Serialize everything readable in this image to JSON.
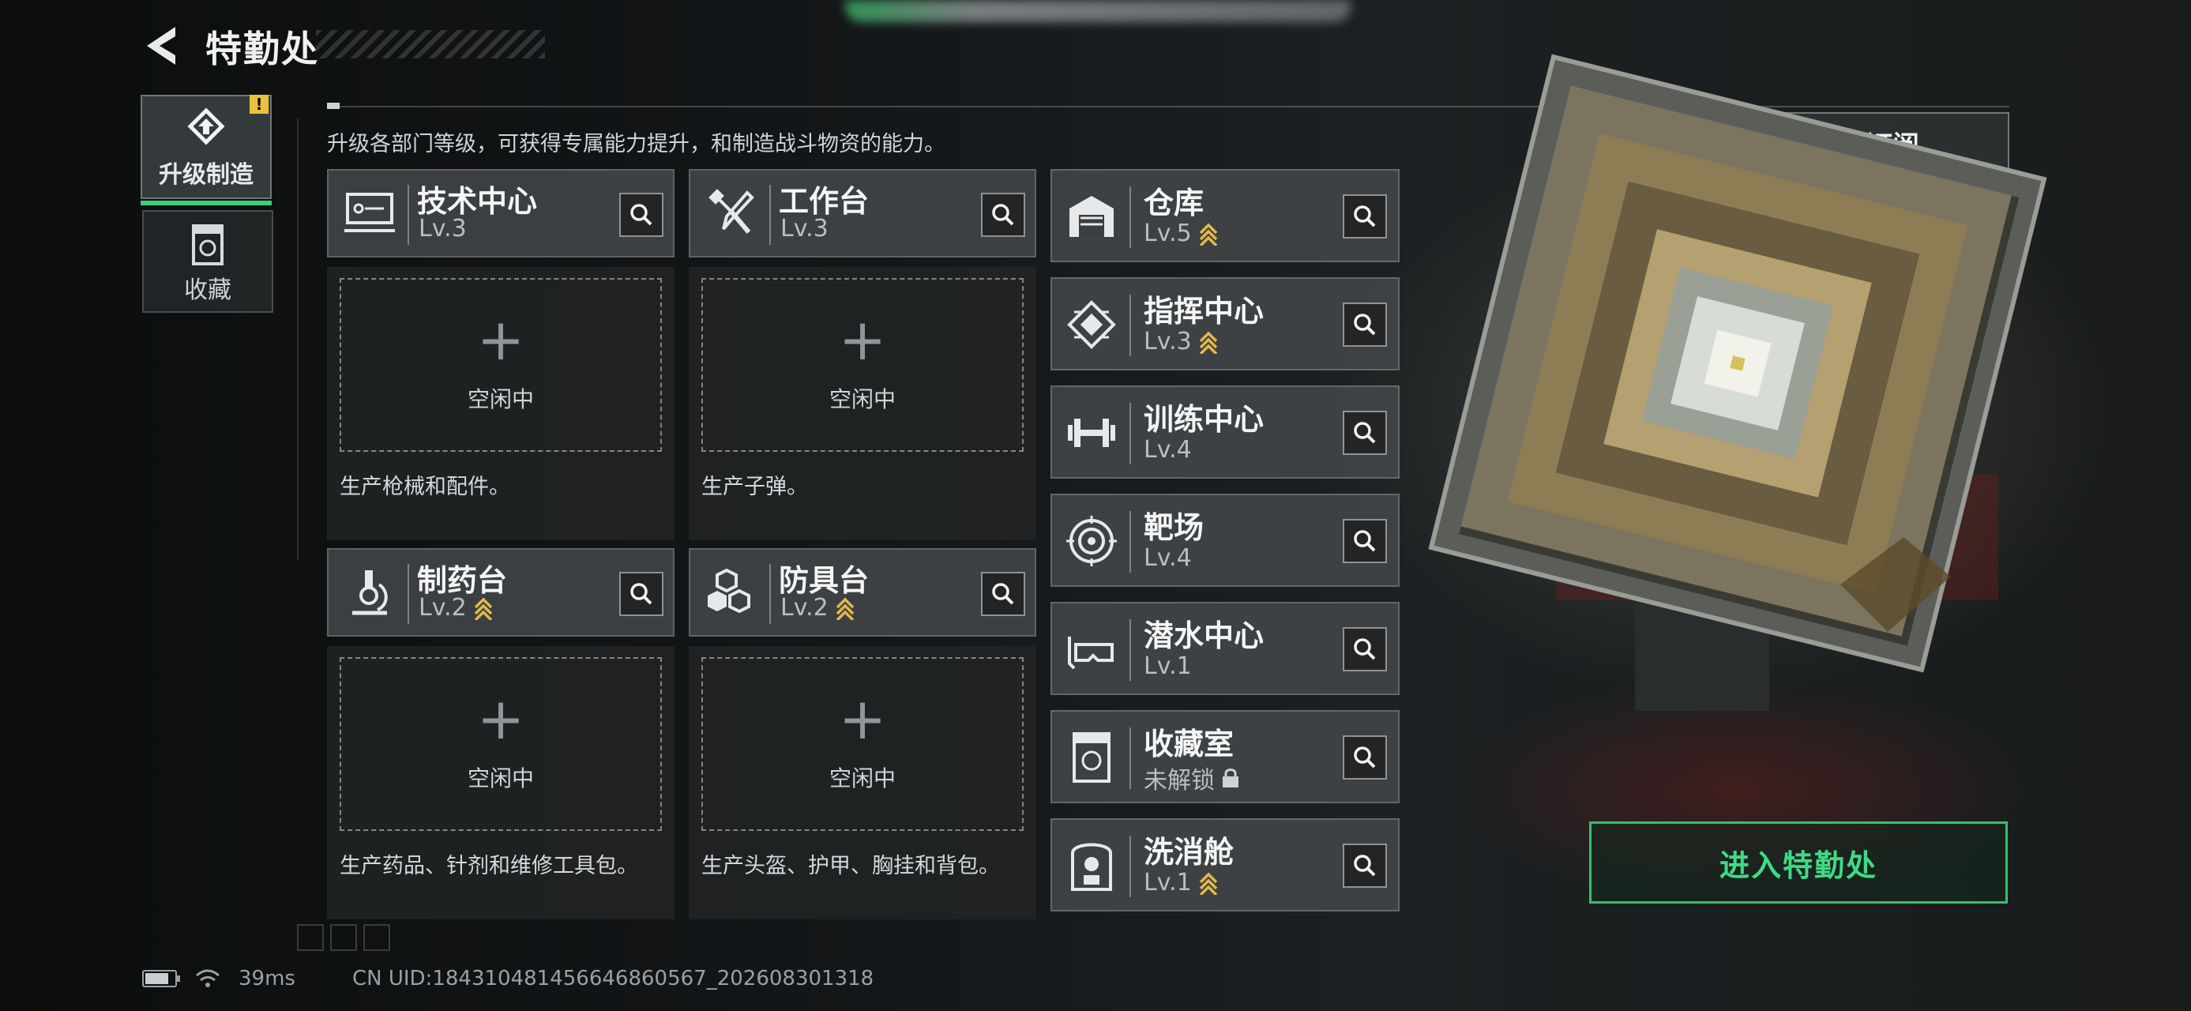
{
  "header": {
    "title": "特勤处",
    "back_icon": "back-arrow-icon"
  },
  "sidebar": {
    "tabs": [
      {
        "label": "升级制造",
        "icon": "upgrade-icon",
        "active": true,
        "alert": "!"
      },
      {
        "label": "收藏",
        "icon": "collection-icon",
        "active": false
      }
    ]
  },
  "description": "升级各部门等级，可获得专属能力提升，和制造战斗物资的能力。",
  "subscribe": {
    "label": "订阅",
    "icon": "bell-plus-icon"
  },
  "production": [
    {
      "name": "技术中心",
      "level": "Lv.3",
      "icon": "computer-icon",
      "upgradable": false,
      "slot_plus": "+",
      "slot_status": "空闲中",
      "desc": "生产枪械和配件。"
    },
    {
      "name": "工作台",
      "level": "Lv.3",
      "icon": "tools-icon",
      "upgradable": false,
      "slot_plus": "+",
      "slot_status": "空闲中",
      "desc": "生产子弹。"
    },
    {
      "name": "制药台",
      "level": "Lv.2",
      "icon": "microscope-icon",
      "upgradable": true,
      "slot_plus": "+",
      "slot_status": "空闲中",
      "desc": "生产药品、针剂和维修工具包。"
    },
    {
      "name": "防具台",
      "level": "Lv.2",
      "icon": "armor-blocks-icon",
      "upgradable": true,
      "slot_plus": "+",
      "slot_status": "空闲中",
      "desc": "生产头盔、护甲、胸挂和背包。"
    }
  ],
  "departments": [
    {
      "name": "仓库",
      "level": "Lv.5",
      "icon": "warehouse-icon",
      "upgradable": true,
      "locked": false
    },
    {
      "name": "指挥中心",
      "level": "Lv.3",
      "icon": "chip-icon",
      "upgradable": true,
      "locked": false
    },
    {
      "name": "训练中心",
      "level": "Lv.4",
      "icon": "dumbbell-icon",
      "upgradable": false,
      "locked": false
    },
    {
      "name": "靶场",
      "level": "Lv.4",
      "icon": "target-icon",
      "upgradable": false,
      "locked": false
    },
    {
      "name": "潜水中心",
      "level": "Lv.1",
      "icon": "diving-mask-icon",
      "upgradable": false,
      "locked": false
    },
    {
      "name": "收藏室",
      "level": "未解锁",
      "icon": "display-case-icon",
      "upgradable": false,
      "locked": true
    },
    {
      "name": "洗消舱",
      "level": "Lv.1",
      "icon": "decontamination-icon",
      "upgradable": true,
      "locked": false
    }
  ],
  "enter_button": "进入特勤处",
  "status": {
    "battery_level": 0.8,
    "ping": "39ms",
    "uid": "CN UID:1843104814566468605​67_202608301318"
  },
  "colors": {
    "accent_green": "#3ddc84",
    "upgrade_gold": "#e2b84a",
    "alert_yellow": "#e9c13c"
  }
}
